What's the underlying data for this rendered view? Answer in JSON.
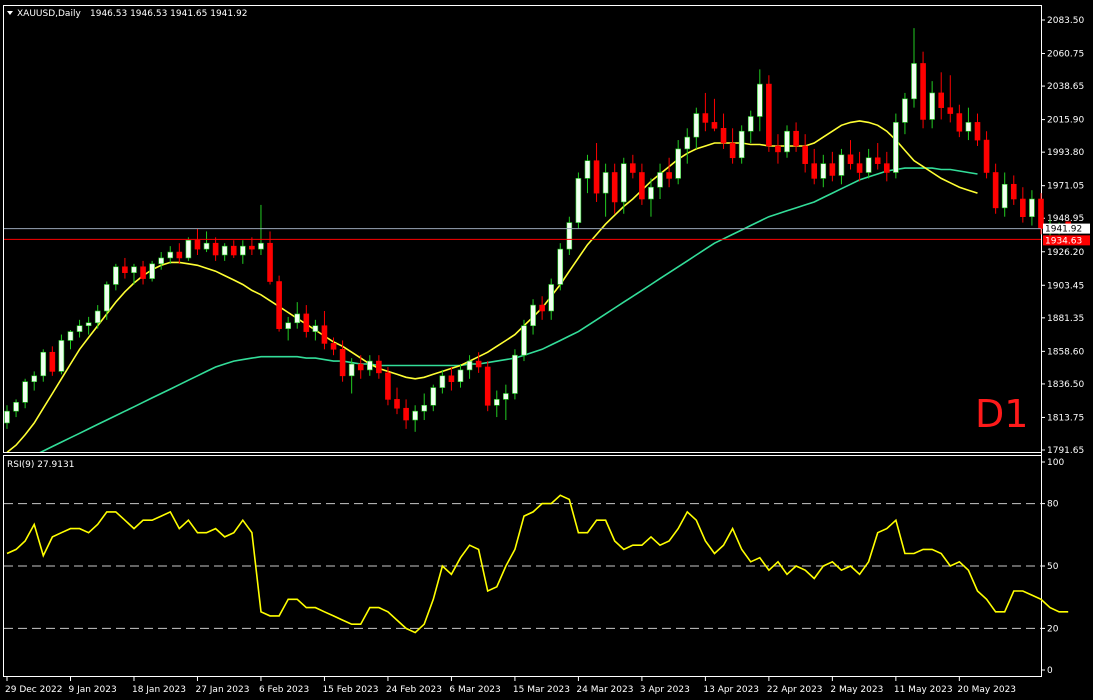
{
  "header": {
    "symbol_label": "XAUUSD,Daily",
    "ohlc_text": "1946.53 1946.53 1941.65 1941.92",
    "menu_icon": "triangle-down-icon"
  },
  "timeframe_label": "D1",
  "rsi_header": "RSI(9) 27.9131",
  "price_labels": {
    "current": "1941.92",
    "line": "1934.63"
  },
  "colors": {
    "bull_candle": "#f0fff0",
    "bear_candle": "#ff0000",
    "ma_fast": "#ffff33",
    "ma_slow": "#33dd99",
    "rsi": "#ffff00",
    "current_price_line": "#9aa6b8",
    "horizontal_line": "#ff0000"
  },
  "chart_data": [
    {
      "type": "candlestick",
      "y_ticks": [
        "2083.50",
        "2060.75",
        "2038.65",
        "2015.90",
        "1993.80",
        "1971.05",
        "1948.95",
        "1926.20",
        "1903.45",
        "1881.35",
        "1858.60",
        "1836.50",
        "1813.75",
        "1791.65"
      ],
      "ylim": [
        1791.65,
        2083.5
      ],
      "x_ticks": [
        "29 Dec 2022",
        "9 Jan 2023",
        "18 Jan 2023",
        "27 Jan 2023",
        "6 Feb 2023",
        "15 Feb 2023",
        "24 Feb 2023",
        "6 Mar 2023",
        "15 Mar 2023",
        "24 Mar 2023",
        "3 Apr 2023",
        "13 Apr 2023",
        "22 Apr 2023",
        "2 May 2023",
        "11 May 2023",
        "20 May 2023"
      ],
      "x_tick_index": [
        0,
        7,
        14,
        21,
        28,
        35,
        42,
        49,
        56,
        63,
        70,
        77,
        84,
        91,
        98,
        105
      ],
      "current_price": 1941.92,
      "horizontal_line": 1934.63,
      "ohlc": [
        [
          1810,
          1822,
          1806,
          1818
        ],
        [
          1818,
          1826,
          1814,
          1824
        ],
        [
          1824,
          1840,
          1820,
          1838
        ],
        [
          1838,
          1845,
          1832,
          1842
        ],
        [
          1842,
          1860,
          1838,
          1858
        ],
        [
          1858,
          1862,
          1842,
          1845
        ],
        [
          1845,
          1870,
          1843,
          1866
        ],
        [
          1866,
          1873,
          1860,
          1872
        ],
        [
          1872,
          1880,
          1868,
          1876
        ],
        [
          1876,
          1882,
          1870,
          1878
        ],
        [
          1878,
          1890,
          1874,
          1886
        ],
        [
          1886,
          1906,
          1880,
          1904
        ],
        [
          1904,
          1918,
          1900,
          1916
        ],
        [
          1916,
          1922,
          1908,
          1912
        ],
        [
          1912,
          1918,
          1904,
          1916
        ],
        [
          1916,
          1920,
          1904,
          1908
        ],
        [
          1908,
          1920,
          1906,
          1918
        ],
        [
          1918,
          1926,
          1914,
          1922
        ],
        [
          1922,
          1930,
          1918,
          1926
        ],
        [
          1926,
          1932,
          1918,
          1922
        ],
        [
          1922,
          1936,
          1920,
          1934
        ],
        [
          1934,
          1942,
          1924,
          1928
        ],
        [
          1928,
          1940,
          1926,
          1932
        ],
        [
          1932,
          1936,
          1920,
          1924
        ],
        [
          1924,
          1932,
          1920,
          1930
        ],
        [
          1930,
          1934,
          1922,
          1924
        ],
        [
          1924,
          1934,
          1918,
          1930
        ],
        [
          1930,
          1936,
          1924,
          1928
        ],
        [
          1928,
          1958,
          1924,
          1932
        ],
        [
          1932,
          1940,
          1904,
          1906
        ],
        [
          1906,
          1910,
          1872,
          1874
        ],
        [
          1874,
          1882,
          1866,
          1878
        ],
        [
          1878,
          1892,
          1874,
          1884
        ],
        [
          1884,
          1890,
          1868,
          1872
        ],
        [
          1872,
          1880,
          1866,
          1876
        ],
        [
          1876,
          1886,
          1860,
          1864
        ],
        [
          1864,
          1868,
          1856,
          1860
        ],
        [
          1860,
          1866,
          1838,
          1842
        ],
        [
          1842,
          1854,
          1830,
          1850
        ],
        [
          1850,
          1856,
          1840,
          1846
        ],
        [
          1846,
          1856,
          1842,
          1852
        ],
        [
          1852,
          1856,
          1840,
          1844
        ],
        [
          1844,
          1848,
          1822,
          1826
        ],
        [
          1826,
          1834,
          1816,
          1820
        ],
        [
          1820,
          1826,
          1806,
          1812
        ],
        [
          1812,
          1822,
          1804,
          1818
        ],
        [
          1818,
          1830,
          1812,
          1822
        ],
        [
          1822,
          1836,
          1818,
          1834
        ],
        [
          1834,
          1846,
          1830,
          1842
        ],
        [
          1842,
          1848,
          1832,
          1838
        ],
        [
          1838,
          1850,
          1834,
          1846
        ],
        [
          1846,
          1856,
          1840,
          1852
        ],
        [
          1852,
          1858,
          1844,
          1848
        ],
        [
          1848,
          1852,
          1818,
          1822
        ],
        [
          1822,
          1832,
          1814,
          1826
        ],
        [
          1826,
          1836,
          1812,
          1830
        ],
        [
          1830,
          1860,
          1826,
          1856
        ],
        [
          1856,
          1880,
          1852,
          1876
        ],
        [
          1876,
          1894,
          1870,
          1890
        ],
        [
          1890,
          1896,
          1880,
          1886
        ],
        [
          1886,
          1908,
          1880,
          1904
        ],
        [
          1904,
          1932,
          1900,
          1928
        ],
        [
          1928,
          1950,
          1924,
          1946
        ],
        [
          1946,
          1980,
          1942,
          1976
        ],
        [
          1976,
          1992,
          1966,
          1988
        ],
        [
          1988,
          2000,
          1960,
          1966
        ],
        [
          1966,
          1986,
          1950,
          1980
        ],
        [
          1980,
          1986,
          1952,
          1960
        ],
        [
          1960,
          1990,
          1952,
          1986
        ],
        [
          1986,
          1992,
          1976,
          1980
        ],
        [
          1980,
          1986,
          1958,
          1962
        ],
        [
          1962,
          1976,
          1950,
          1970
        ],
        [
          1970,
          1986,
          1962,
          1980
        ],
        [
          1980,
          1990,
          1970,
          1976
        ],
        [
          1976,
          2002,
          1972,
          1996
        ],
        [
          1996,
          2010,
          1986,
          2004
        ],
        [
          2004,
          2024,
          1996,
          2020
        ],
        [
          2020,
          2034,
          2008,
          2014
        ],
        [
          2014,
          2030,
          2008,
          2010
        ],
        [
          2010,
          2020,
          1996,
          2000
        ],
        [
          2000,
          2010,
          1986,
          1990
        ],
        [
          1990,
          2012,
          1986,
          2008
        ],
        [
          2008,
          2022,
          2000,
          2018
        ],
        [
          2018,
          2050,
          2008,
          2040
        ],
        [
          2040,
          2046,
          1994,
          1998
        ],
        [
          1998,
          2006,
          1986,
          1994
        ],
        [
          1994,
          2012,
          1990,
          2008
        ],
        [
          2008,
          2014,
          1994,
          1998
        ],
        [
          1998,
          2006,
          1980,
          1986
        ],
        [
          1986,
          1996,
          1972,
          1976
        ],
        [
          1976,
          1992,
          1970,
          1986
        ],
        [
          1986,
          1994,
          1974,
          1978
        ],
        [
          1978,
          1996,
          1972,
          1992
        ],
        [
          1992,
          2002,
          1982,
          1986
        ],
        [
          1986,
          1994,
          1974,
          1980
        ],
        [
          1980,
          1996,
          1976,
          1990
        ],
        [
          1990,
          2000,
          1982,
          1986
        ],
        [
          1986,
          1994,
          1974,
          1980
        ],
        [
          1980,
          2020,
          1976,
          2014
        ],
        [
          2014,
          2034,
          2006,
          2030
        ],
        [
          2030,
          2078,
          2024,
          2054
        ],
        [
          2054,
          2062,
          2010,
          2016
        ],
        [
          2016,
          2042,
          2010,
          2034
        ],
        [
          2034,
          2048,
          2016,
          2024
        ],
        [
          2024,
          2046,
          2014,
          2020
        ],
        [
          2020,
          2026,
          2004,
          2008
        ],
        [
          2008,
          2024,
          2002,
          2014
        ],
        [
          2014,
          2020,
          1998,
          2002
        ],
        [
          2002,
          2008,
          1976,
          1980
        ],
        [
          1980,
          1986,
          1952,
          1956
        ],
        [
          1956,
          1980,
          1950,
          1972
        ],
        [
          1972,
          1978,
          1958,
          1962
        ],
        [
          1962,
          1970,
          1946,
          1950
        ],
        [
          1950,
          1968,
          1944,
          1962
        ],
        [
          1962,
          1966,
          1938,
          1942
        ],
        [
          1942,
          1948,
          1936,
          1942
        ],
        [
          1942,
          1946,
          1938,
          1944
        ],
        [
          1946.53,
          1946.53,
          1941.65,
          1941.92
        ]
      ],
      "ma_fast": [
        1790,
        1795,
        1802,
        1810,
        1820,
        1830,
        1840,
        1850,
        1860,
        1868,
        1876,
        1884,
        1892,
        1899,
        1905,
        1910,
        1914,
        1917,
        1919,
        1919,
        1918,
        1917,
        1915,
        1913,
        1910,
        1907,
        1904,
        1900,
        1897,
        1893,
        1889,
        1885,
        1881,
        1877,
        1873,
        1869,
        1865,
        1862,
        1858,
        1854,
        1850,
        1847,
        1845,
        1843,
        1841,
        1840,
        1841,
        1843,
        1845,
        1847,
        1849,
        1852,
        1855,
        1858,
        1862,
        1866,
        1870,
        1876,
        1882,
        1888,
        1896,
        1904,
        1913,
        1922,
        1931,
        1938,
        1945,
        1951,
        1957,
        1962,
        1968,
        1974,
        1979,
        1984,
        1989,
        1993,
        1996,
        1998,
        2000,
        2000,
        2000,
        2000,
        1999,
        1999,
        1998,
        1998,
        1998,
        1998,
        1998,
        2000,
        2004,
        2008,
        2012,
        2014,
        2015,
        2014,
        2012,
        2008,
        2002,
        1995,
        1988,
        1984,
        1980,
        1976,
        1973,
        1970,
        1968,
        1966
      ],
      "ma_slow": [
        1780,
        1782,
        1785,
        1788,
        1791,
        1794,
        1797,
        1800,
        1803,
        1806,
        1809,
        1812,
        1815,
        1818,
        1821,
        1824,
        1827,
        1830,
        1833,
        1836,
        1839,
        1842,
        1845,
        1848,
        1850,
        1852,
        1853,
        1854,
        1855,
        1855,
        1855,
        1855,
        1855,
        1854,
        1854,
        1853,
        1852,
        1852,
        1851,
        1850,
        1850,
        1849,
        1849,
        1849,
        1849,
        1849,
        1849,
        1849,
        1849,
        1849,
        1849,
        1850,
        1850,
        1851,
        1852,
        1853,
        1854,
        1856,
        1858,
        1860,
        1863,
        1866,
        1869,
        1872,
        1876,
        1880,
        1884,
        1888,
        1892,
        1896,
        1900,
        1904,
        1908,
        1912,
        1916,
        1920,
        1924,
        1928,
        1932,
        1935,
        1938,
        1941,
        1944,
        1947,
        1950,
        1952,
        1954,
        1956,
        1958,
        1960,
        1963,
        1966,
        1969,
        1972,
        1975,
        1977,
        1979,
        1981,
        1982,
        1983,
        1983,
        1983,
        1983,
        1982,
        1982,
        1981,
        1980,
        1979
      ]
    },
    {
      "type": "line",
      "name": "RSI(9) 27.9131",
      "y_ticks": [
        "100",
        "80",
        "50",
        "20",
        "0"
      ],
      "ylim": [
        0,
        100
      ],
      "levels": [
        80,
        50,
        20
      ],
      "values": [
        56,
        58,
        62,
        70,
        55,
        64,
        66,
        68,
        68,
        66,
        70,
        76,
        76,
        72,
        68,
        72,
        72,
        74,
        76,
        68,
        72,
        66,
        66,
        68,
        64,
        66,
        72,
        66,
        28,
        26,
        26,
        34,
        34,
        30,
        30,
        28,
        26,
        24,
        22,
        22,
        30,
        30,
        28,
        24,
        20,
        18,
        22,
        34,
        50,
        46,
        54,
        60,
        58,
        38,
        40,
        50,
        58,
        74,
        76,
        80,
        80,
        84,
        82,
        66,
        66,
        72,
        72,
        62,
        58,
        60,
        60,
        64,
        60,
        62,
        68,
        76,
        72,
        62,
        56,
        60,
        68,
        58,
        52,
        54,
        48,
        52,
        46,
        50,
        48,
        44,
        50,
        52,
        48,
        50,
        46,
        52,
        66,
        68,
        72,
        56,
        56,
        58,
        58,
        56,
        50,
        52,
        48,
        38,
        34,
        28,
        28,
        38,
        38,
        36,
        34,
        30,
        28,
        28
      ]
    }
  ]
}
